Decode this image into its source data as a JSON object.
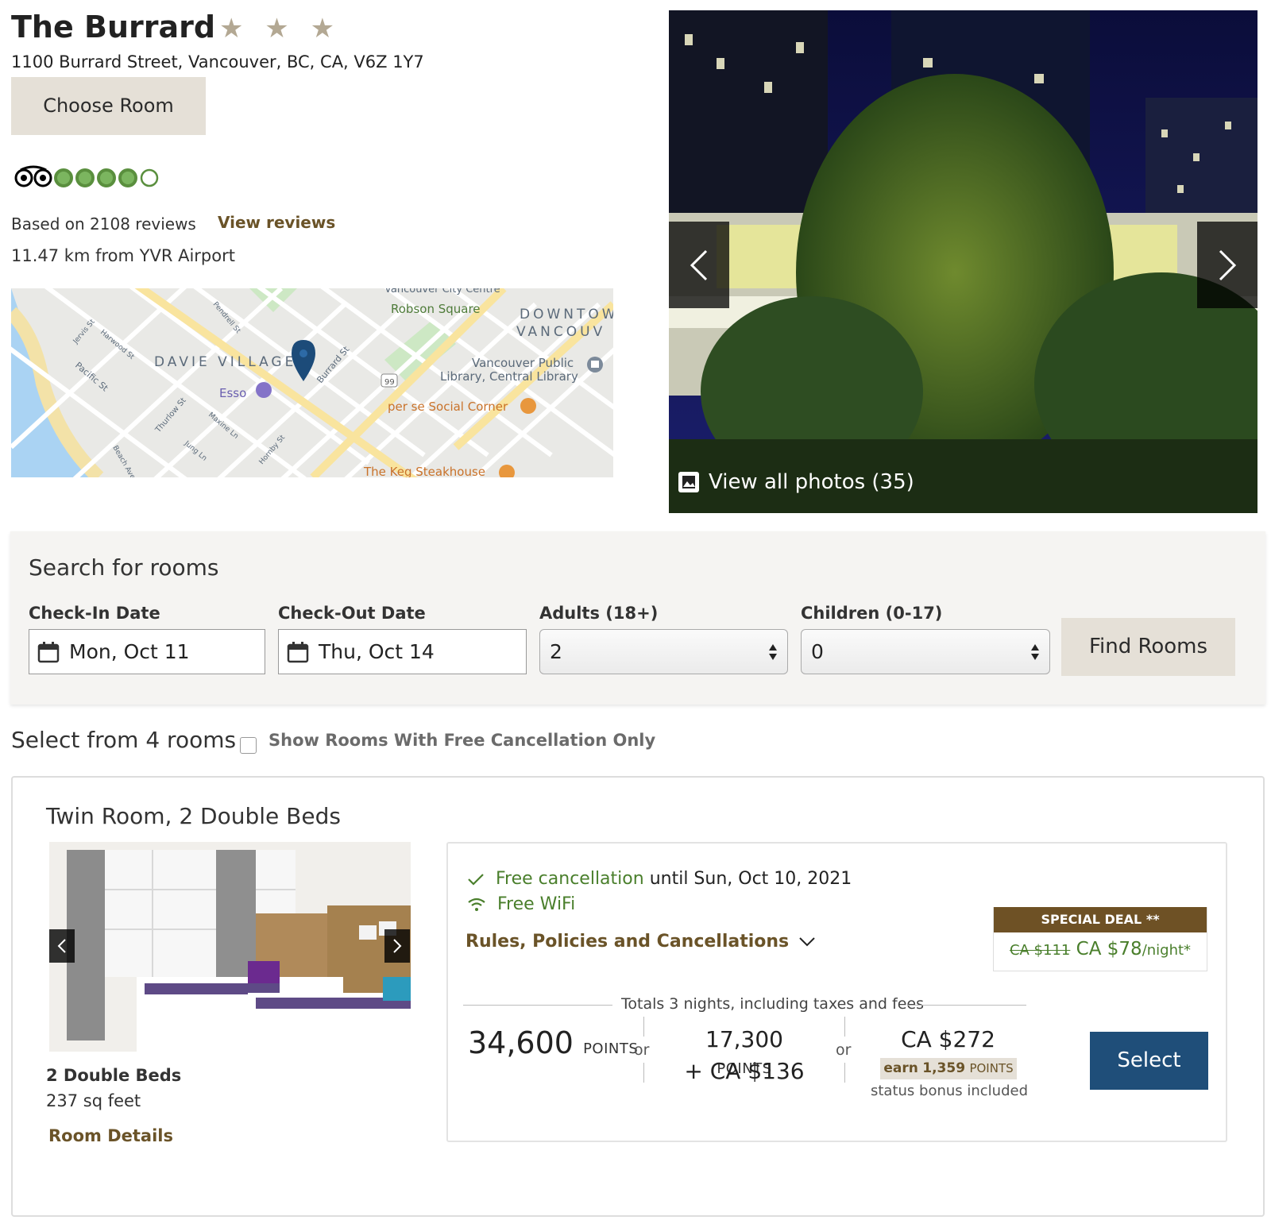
{
  "hotel": {
    "name": "The Burrard",
    "stars": "★ ★ ★",
    "address": "1100 Burrard Street, Vancouver, BC, CA, V6Z 1Y7",
    "choose_room": "Choose Room",
    "rating_bubbles": 4,
    "rating_max": 5,
    "reviews_text": "Based on 2108 reviews",
    "view_reviews": "View reviews",
    "distance": "11.47 km from YVR Airport"
  },
  "map": {
    "labels": {
      "robson": "Robson Square",
      "downtown1": "DOWNTOW",
      "downtown2": "VANCOUV",
      "davie": "DAVIE VILLAGE",
      "library1": "Vancouver Public",
      "library2": "Library, Central Library",
      "esso": "Esso",
      "perse": "per se Social Corner",
      "keg": "The Keg Steakhouse",
      "vcc": "Vancouver City Centre",
      "route": "99",
      "pacific": "Pacific St",
      "jervis": "Jervis St",
      "harwood": "Harwood St",
      "burrard": "Burrard St",
      "thurlow": "Thurlow St",
      "hornby": "Hornby St",
      "beach": "Beach Ave",
      "pendrell": "Pendrell St",
      "jung": "Jung Ln",
      "maxine": "Maxine Ln"
    }
  },
  "photo": {
    "view_all": "View all photos (35)"
  },
  "search": {
    "title": "Search for rooms",
    "checkin_label": "Check-In Date",
    "checkin_value": "Mon, Oct 11",
    "checkout_label": "Check-Out Date",
    "checkout_value": "Thu, Oct 14",
    "adults_label": "Adults (18+)",
    "adults_value": "2",
    "children_label": "Children (0-17)",
    "children_value": "0",
    "find_rooms": "Find Rooms"
  },
  "rooms": {
    "select_title": "Select from 4 rooms",
    "free_cancel_only": "Show Rooms With Free Cancellation Only",
    "room": {
      "title": "Twin Room, 2 Double Beds",
      "beds": "2 Double Beds",
      "sqft": "237 sq feet",
      "details_link": "Room Details",
      "free_cancel_strong": "Free cancellation",
      "free_cancel_rest": "until Sun, Oct 10, 2021",
      "free_wifi": "Free WiFi",
      "rules": "Rules, Policies and Cancellations",
      "deal_head": "SPECIAL DEAL **",
      "deal_old": "CA $111",
      "deal_new": "CA $78",
      "deal_unit": "/night*",
      "totals": "Totals 3 nights, including taxes and fees",
      "points_value": "34,600",
      "points_label": "POINTS",
      "or": "or",
      "mix_points": "17,300",
      "mix_cash": "+ CA $136",
      "cash": "CA $272",
      "earn_prefix": "earn",
      "earn_points": "1,359",
      "status_bonus": "status bonus included",
      "select": "Select"
    }
  },
  "colors": {
    "brand_brown": "#6a5328",
    "deal_brown": "#6e5125",
    "green": "#4a7f2c",
    "select_blue": "#1f4e79",
    "button_beige": "#e5e0d7"
  }
}
